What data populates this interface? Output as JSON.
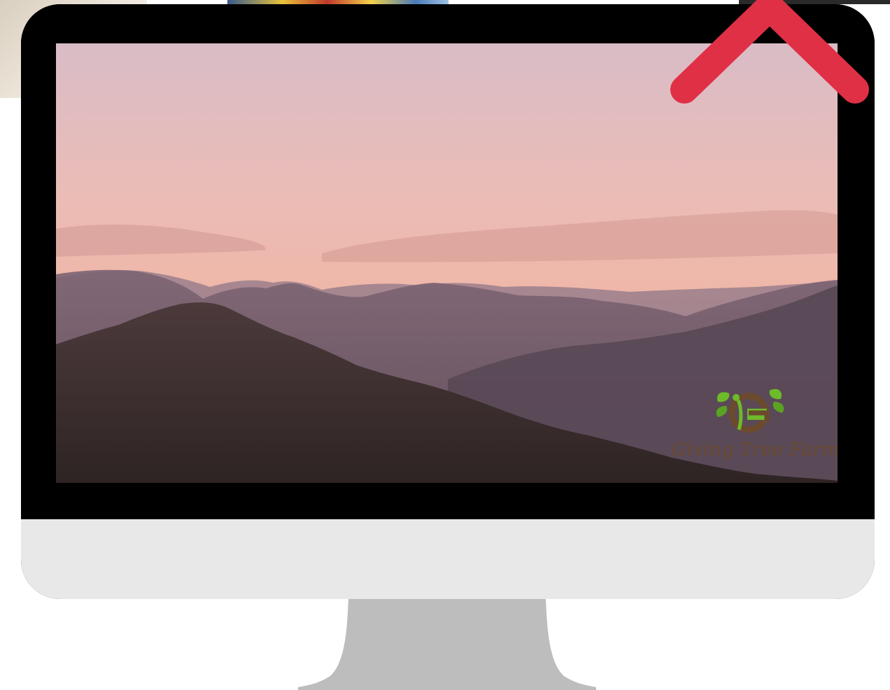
{
  "screen": {
    "wallpaper_icon": "mountain-sunset-image"
  },
  "logo": {
    "text": "Giving Tree Farms",
    "icon": "tree-leaves-g-icon",
    "text_color": "#6b4a2e",
    "leaf_color": "#6dbb2a"
  },
  "close": {
    "icon": "close-icon",
    "color": "#e03046"
  },
  "colors": {
    "bezel": "#000000",
    "chin": "#e8e8e8",
    "stand": "#bdbdbd"
  }
}
